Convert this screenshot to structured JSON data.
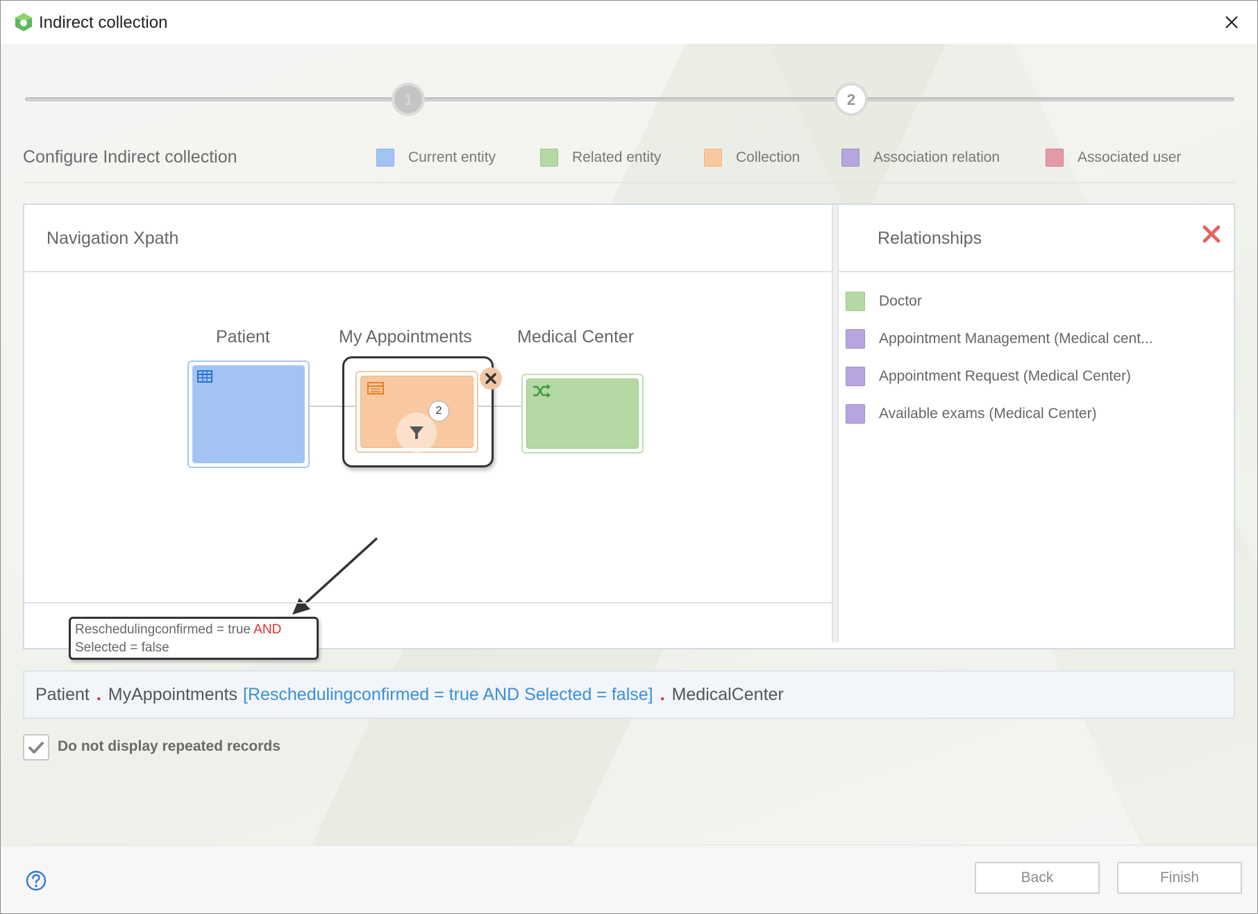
{
  "window": {
    "title": "Indirect collection"
  },
  "stepper": {
    "steps": [
      {
        "label": "1"
      },
      {
        "label": "2"
      }
    ]
  },
  "config": {
    "title": "Configure Indirect collection",
    "legend": [
      {
        "label": "Current entity",
        "color": "#a3c4f3"
      },
      {
        "label": "Related entity",
        "color": "#b5d8a5"
      },
      {
        "label": "Collection",
        "color": "#f8c9a0"
      },
      {
        "label": "Association relation",
        "color": "#b7a6de"
      },
      {
        "label": "Associated user",
        "color": "#e39aa6"
      }
    ]
  },
  "navigation": {
    "title": "Navigation Xpath",
    "entities": [
      {
        "label": "Patient",
        "kind": "current",
        "icon": "table-icon"
      },
      {
        "label": "My Appointments",
        "kind": "collection",
        "icon": "list-icon",
        "filter_count": "2"
      },
      {
        "label": "Medical Center",
        "kind": "related",
        "icon": "shuffle-icon"
      }
    ],
    "filter_callout": {
      "line1": "Reschedulingconfirmed = true",
      "operator": "AND",
      "line2": "Selected = false"
    }
  },
  "relationships": {
    "title": "Relationships",
    "items": [
      {
        "label": "Doctor",
        "color": "#b5d8a5"
      },
      {
        "label": "Appointment Management (Medical cent...",
        "color": "#b7a6de"
      },
      {
        "label": "Appointment Request (Medical Center)",
        "color": "#b7a6de"
      },
      {
        "label": "Available exams (Medical Center)",
        "color": "#b7a6de"
      }
    ]
  },
  "xpath": {
    "part1": "Patient",
    "sep": ".",
    "part2": "MyAppointments",
    "condition": "[Reschedulingconfirmed = true AND Selected = false]",
    "part3": "MedicalCenter"
  },
  "options": {
    "no_repeat_label": "Do not display repeated records",
    "no_repeat_checked": true
  },
  "footer": {
    "back_label": "Back",
    "finish_label": "Finish"
  }
}
